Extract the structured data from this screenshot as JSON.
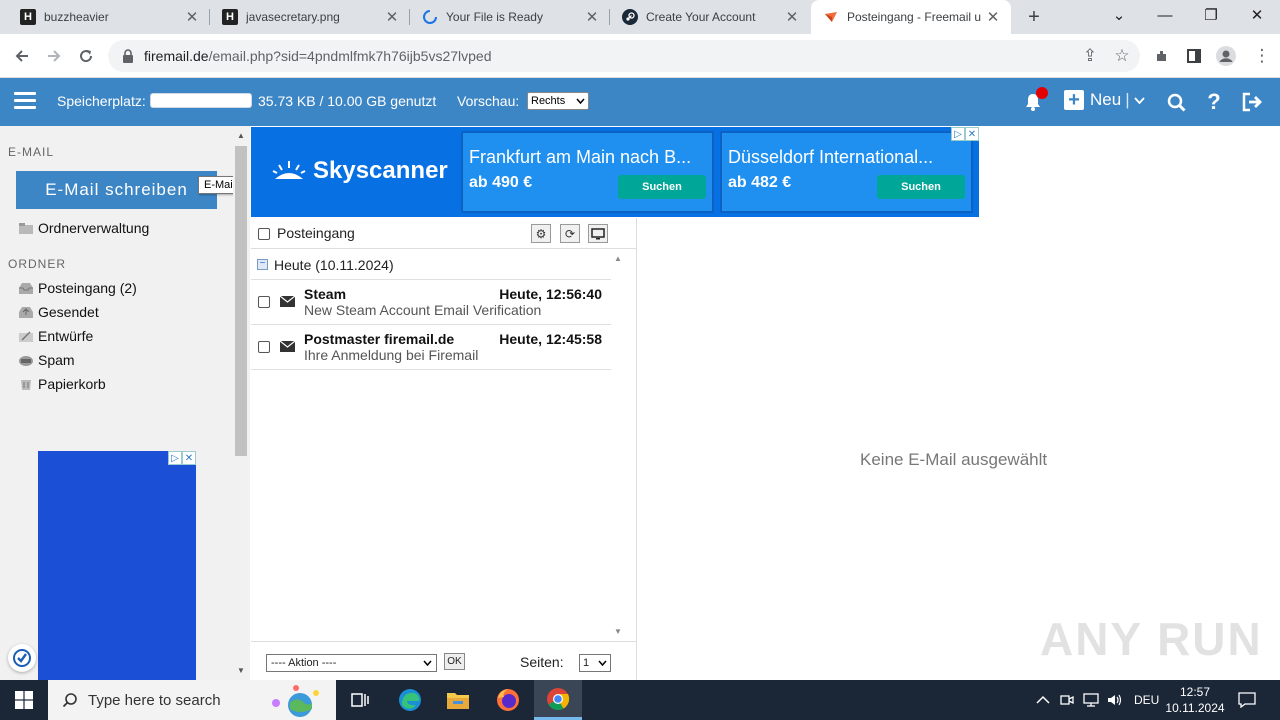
{
  "browser": {
    "tabs": [
      {
        "title": "buzzheavier",
        "icon": "h-letter-icon",
        "active": false
      },
      {
        "title": "javasecretary.png",
        "icon": "h-letter-icon",
        "active": false
      },
      {
        "title": "Your File is Ready",
        "icon": "loading-icon",
        "active": false
      },
      {
        "title": "Create Your Account",
        "icon": "steam-icon",
        "active": false
      },
      {
        "title": "Posteingang - Freemail u",
        "icon": "firemail-icon",
        "active": true
      }
    ],
    "url_host": "firemail.de",
    "url_rest": "/email.php?sid=4pndmlfmk7h76ijb5vs27lvped"
  },
  "header": {
    "storage_label": "Speicherplatz:",
    "storage_text": "35.73 KB / 10.00 GB genutzt",
    "storage_fraction": 0.0,
    "preview_label": "Vorschau:",
    "preview_value": "Rechts",
    "new_label": "Neu"
  },
  "sidebar": {
    "email_section": "E-MAIL",
    "compose_label": "E-Mail schreiben",
    "tooltip": "E-Mail",
    "folder_admin": "Ordnerverwaltung",
    "folders_section": "ORDNER",
    "folders": [
      {
        "label": "Posteingang (2)"
      },
      {
        "label": "Gesendet"
      },
      {
        "label": "Entwürfe"
      },
      {
        "label": "Spam"
      },
      {
        "label": "Papierkorb"
      }
    ]
  },
  "banner": {
    "brand": "Skyscanner",
    "deals": [
      {
        "destination": "Frankfurt am Main nach B...",
        "price": "ab 490 €",
        "button": "Suchen"
      },
      {
        "destination": "Düsseldorf International...",
        "price": "ab 482 €",
        "button": "Suchen"
      }
    ]
  },
  "maillist": {
    "folder_title": "Posteingang",
    "group_label": "Heute (10.11.2024)",
    "messages": [
      {
        "from": "Steam",
        "time": "Heute, 12:56:40",
        "subject": "New Steam Account Email Verification"
      },
      {
        "from": "Postmaster firemail.de",
        "time": "Heute, 12:45:58",
        "subject": "Ihre Anmeldung bei Firemail"
      }
    ],
    "action_label": "---- Aktion ----",
    "ok_label": "OK",
    "pages_label": "Seiten:",
    "pages_value": "1"
  },
  "reading_pane": {
    "empty_text": "Keine E-Mail ausgewählt",
    "watermark": "ANY RUN"
  },
  "taskbar": {
    "search_placeholder": "Type here to search",
    "language": "DEU",
    "time": "12:57",
    "date": "10.11.2024"
  },
  "colors": {
    "brand_blue": "#3d86c6",
    "ad_blue": "#0770e3",
    "notification_red": "#e30000"
  }
}
